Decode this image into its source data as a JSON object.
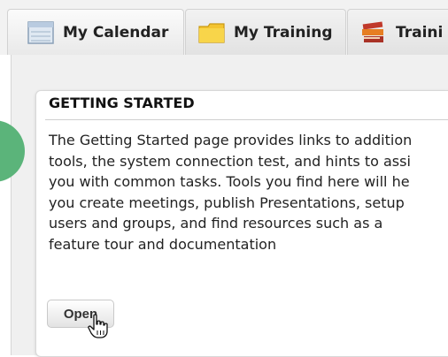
{
  "tabs": [
    {
      "label": "My Calendar",
      "icon": "calendar-icon"
    },
    {
      "label": "My Training",
      "icon": "folder-icon"
    },
    {
      "label": "Traini",
      "icon": "books-icon"
    }
  ],
  "card": {
    "title": "GETTING STARTED",
    "body_lines": [
      "The Getting Started page provides links to addition",
      "tools, the system connection test, and hints to assi",
      "you with common tasks. Tools you find here will he",
      "you create meetings, publish Presentations, setup",
      "users and groups, and find resources such as a",
      "feature tour and documentation"
    ],
    "open_label": "Open"
  },
  "colors": {
    "accent_green": "#5bb47a",
    "folder_yellow": "#f4c430",
    "books_red": "#c0392b"
  }
}
